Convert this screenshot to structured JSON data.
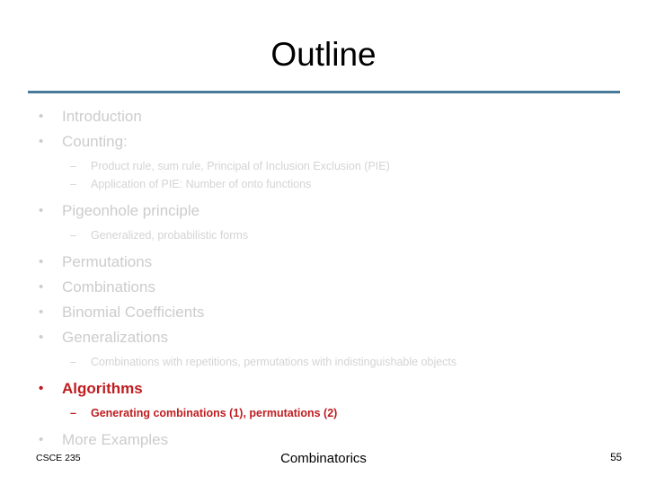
{
  "slide": {
    "title": "Outline",
    "rule_color": "#4a7a9b",
    "dim_color": "#cccccc",
    "highlight_color": "#bf1d20",
    "bullet_glyph": "•",
    "dash_glyph": "–"
  },
  "outline": [
    {
      "level": 1,
      "text": "Introduction",
      "highlighted": false
    },
    {
      "level": 1,
      "text": "Counting:",
      "highlighted": false
    },
    {
      "level": 2,
      "text": "Product rule, sum rule, Principal of Inclusion Exclusion (PIE)",
      "highlighted": false
    },
    {
      "level": 2,
      "text": "Application of PIE: Number of onto functions",
      "highlighted": false
    },
    {
      "level": 1,
      "text": "Pigeonhole principle",
      "highlighted": false
    },
    {
      "level": 2,
      "text": "Generalized, probabilistic forms",
      "highlighted": false
    },
    {
      "level": 1,
      "text": "Permutations",
      "highlighted": false
    },
    {
      "level": 1,
      "text": "Combinations",
      "highlighted": false
    },
    {
      "level": 1,
      "text": "Binomial Coefficients",
      "highlighted": false
    },
    {
      "level": 1,
      "text": "Generalizations",
      "highlighted": false
    },
    {
      "level": 2,
      "text": "Combinations with repetitions, permutations with indistinguishable objects",
      "highlighted": false
    },
    {
      "level": 1,
      "text": "Algorithms",
      "highlighted": true
    },
    {
      "level": 2,
      "text": "Generating combinations (1), permutations (2)",
      "highlighted": true
    },
    {
      "level": 1,
      "text": "More Examples",
      "highlighted": false
    }
  ],
  "footer": {
    "course": "CSCE 235",
    "topic": "Combinatorics",
    "page_number": "55"
  }
}
